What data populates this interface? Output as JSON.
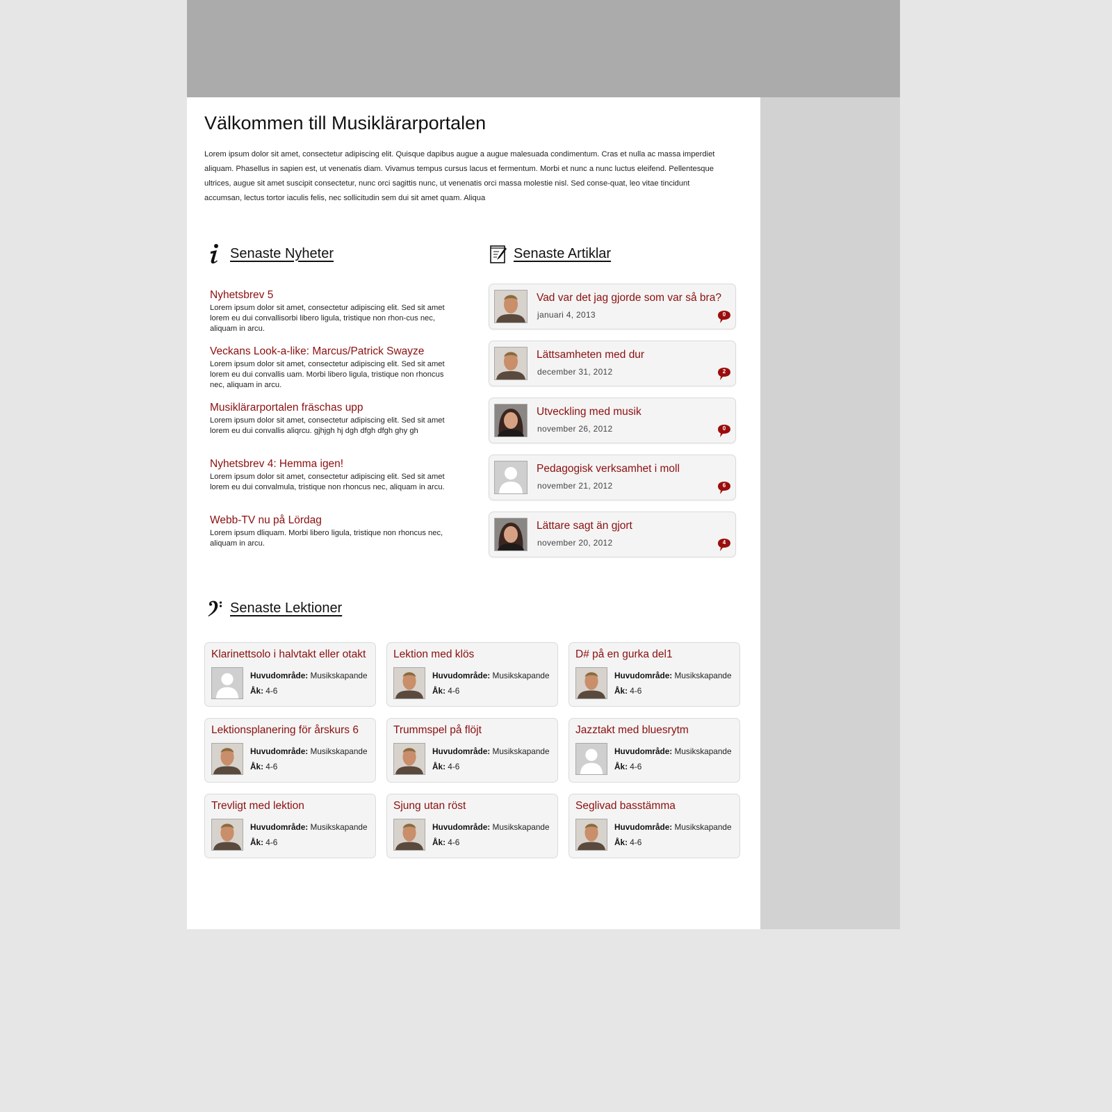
{
  "welcome": {
    "title": "Välkommen till Musiklärarportalen",
    "text": "Lorem ipsum dolor sit amet, consectetur adipiscing elit. Quisque dapibus augue a augue malesuada condimentum. Cras et nulla ac massa imperdiet aliquam. Phasellus in sapien est, ut venenatis diam. Vivamus tempus cursus lacus et fermentum. Morbi et nunc a nunc luctus eleifend. Pellentesque ultrices, augue sit amet suscipit consectetur, nunc orci sagittis nunc, ut venenatis orci massa molestie nisl. Sed conse-quat, leo vitae tincidunt accumsan, lectus tortor iaculis felis, nec sollicitudin sem dui sit amet quam. Aliqua"
  },
  "news": {
    "heading": "Senaste Nyheter",
    "icon": "info-icon",
    "items": [
      {
        "title": "Nyhetsbrev 5",
        "text": "Lorem ipsum dolor sit amet, consectetur adipiscing elit. Sed sit amet lorem eu dui convallisorbi libero ligula, tristique non rhon-cus nec, aliquam in arcu."
      },
      {
        "title": "Veckans Look-a-like: Marcus/Patrick Swayze",
        "text": "Lorem ipsum dolor sit amet, consectetur adipiscing elit. Sed sit amet lorem eu dui convallis uam. Morbi libero ligula, tristique non rhoncus nec, aliquam in arcu."
      },
      {
        "title": "Musiklärarportalen fräschas upp",
        "text": "Lorem ipsum dolor sit amet, consectetur adipiscing elit. Sed sit amet lorem eu dui convallis aliqrcu. gjhjgh hj dgh dfgh dfgh ghy gh"
      },
      {
        "title": "Nyhetsbrev 4: Hemma igen!",
        "text": "Lorem ipsum dolor sit amet, consectetur adipiscing elit. Sed sit amet lorem eu dui convalmula, tristique non rhoncus nec, aliquam in arcu."
      },
      {
        "title": "Webb-TV nu på Lördag",
        "text": "Lorem ipsum dliquam. Morbi libero ligula, tristique non rhoncus nec, aliquam in arcu."
      }
    ]
  },
  "articles": {
    "heading": "Senaste Artiklar",
    "icon": "notepad-icon",
    "items": [
      {
        "title": "Vad var det jag gjorde som var så bra?",
        "date": "januari 4, 2013",
        "comments": "0",
        "avatar": "man"
      },
      {
        "title": "Lättsamheten med dur",
        "date": "december 31, 2012",
        "comments": "2",
        "avatar": "man"
      },
      {
        "title": "Utveckling med musik",
        "date": "november 26, 2012",
        "comments": "0",
        "avatar": "woman"
      },
      {
        "title": "Pedagogisk verksamhet i moll",
        "date": "november 21, 2012",
        "comments": "6",
        "avatar": "placeholder"
      },
      {
        "title": "Lättare sagt än gjort",
        "date": "november 20, 2012",
        "comments": "4",
        "avatar": "woman"
      }
    ],
    "comment_color": "#9b0d0d"
  },
  "lessons": {
    "heading": "Senaste Lektioner",
    "icon": "bass-clef-icon",
    "area_label": "Huvudområde:",
    "grade_label": "Åk:",
    "items": [
      {
        "title": "Klarinettsolo i halvtakt eller otakt",
        "area": "Musikskapande",
        "grade": "4-6",
        "avatar": "placeholder"
      },
      {
        "title": "Lektion med klös",
        "area": "Musikskapande",
        "grade": "4-6",
        "avatar": "man"
      },
      {
        "title": "D# på en gurka del1",
        "area": "Musikskapande",
        "grade": "4-6",
        "avatar": "man"
      },
      {
        "title": "Lektionsplanering för årskurs 6",
        "area": "Musikskapande",
        "grade": "4-6",
        "avatar": "man"
      },
      {
        "title": "Trummspel på flöjt",
        "area": "Musikskapande",
        "grade": "4-6",
        "avatar": "man"
      },
      {
        "title": "Jazztakt med bluesrytm",
        "area": "Musikskapande",
        "grade": "4-6",
        "avatar": "placeholder"
      },
      {
        "title": "Trevligt med lektion",
        "area": "Musikskapande",
        "grade": "4-6",
        "avatar": "man"
      },
      {
        "title": "Sjung utan röst",
        "area": "Musikskapande",
        "grade": "4-6",
        "avatar": "man"
      },
      {
        "title": "Seglivad basstämma",
        "area": "Musikskapande",
        "grade": "4-6",
        "avatar": "man"
      }
    ]
  },
  "colors": {
    "link": "#8b0f0f",
    "banner": "#ababab",
    "sidebar": "#d2d2d2",
    "background": "#e6e6e6"
  }
}
